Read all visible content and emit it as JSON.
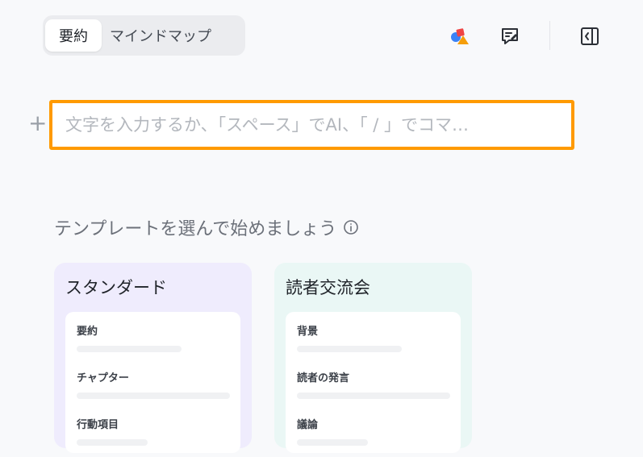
{
  "tabs": [
    {
      "label": "要約"
    },
    {
      "label": "マインドマップ"
    }
  ],
  "toolbar": {
    "icons": [
      "ai-shapes-icon",
      "chat-edit-icon",
      "sidebar-collapse-icon"
    ]
  },
  "editor": {
    "placeholder": "文字を入力するか、「スペース」でAI、「 / 」でコマ…",
    "plus_label": "+"
  },
  "templates": {
    "heading": "テンプレートを選んで始めましょう",
    "cards": [
      {
        "title": "スタンダード",
        "items": [
          "要約",
          "チャプター",
          "行動項目"
        ]
      },
      {
        "title": "読者交流会",
        "items": [
          "背景",
          "読者の発言",
          "議論"
        ]
      }
    ]
  }
}
